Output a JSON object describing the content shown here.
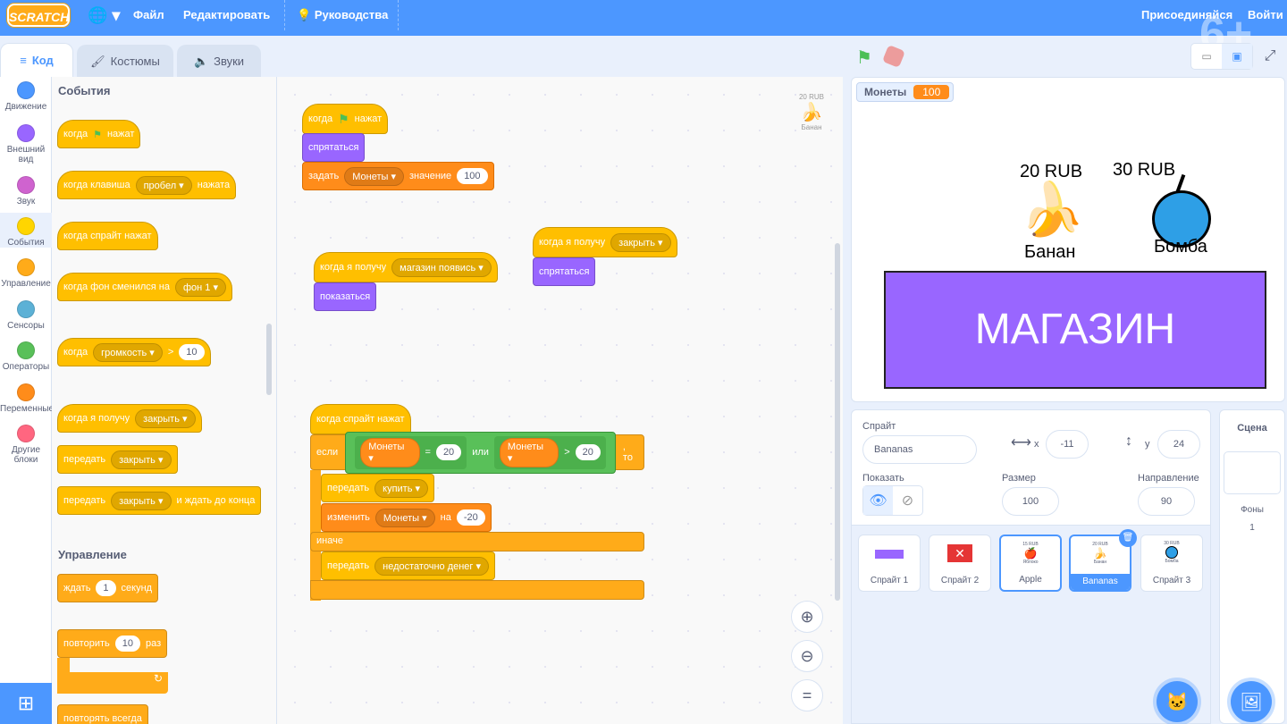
{
  "menubar": {
    "logo": "SCRATCH",
    "file": "Файл",
    "edit": "Редактировать",
    "tutorials": "Руководства",
    "join": "Присоединяйся",
    "signin": "Войти",
    "age_badge": "6+"
  },
  "tabs": {
    "code": "Код",
    "costumes": "Костюмы",
    "sounds": "Звуки"
  },
  "categories": [
    {
      "label": "Движение",
      "color": "#4c97ff"
    },
    {
      "label": "Внешний вид",
      "color": "#9966ff"
    },
    {
      "label": "Звук",
      "color": "#cf63cf"
    },
    {
      "label": "События",
      "color": "#ffd500"
    },
    {
      "label": "Управление",
      "color": "#ffab19"
    },
    {
      "label": "Сенсоры",
      "color": "#5cb1d6"
    },
    {
      "label": "Операторы",
      "color": "#59c059"
    },
    {
      "label": "Переменные",
      "color": "#ff8c1a"
    },
    {
      "label": "Другие блоки",
      "color": "#ff6680"
    }
  ],
  "palette": {
    "events_title": "События",
    "when_flag": [
      "когда",
      "нажат"
    ],
    "when_key": [
      "когда клавиша",
      "пробел",
      "нажата"
    ],
    "when_sprite_clicked": "когда спрайт нажат",
    "when_backdrop": [
      "когда фон сменился на",
      "фон 1"
    ],
    "when_loudness": [
      "когда",
      "громкость",
      ">",
      "10"
    ],
    "when_receive": [
      "когда я получу",
      "закрыть"
    ],
    "broadcast": [
      "передать",
      "закрыть"
    ],
    "broadcast_wait": [
      "передать",
      "закрыть",
      "и ждать до конца"
    ],
    "control_title": "Управление",
    "wait": [
      "ждать",
      "1",
      "секунд"
    ],
    "repeat": [
      "повторить",
      "10",
      "раз"
    ],
    "forever": "повторять всегда"
  },
  "workspace": {
    "corner_price": "20 RUB",
    "corner_name": "Банан",
    "script1": {
      "hat": [
        "когда",
        "нажат"
      ],
      "hide": "спрятаться",
      "set": [
        "задать",
        "Монеты",
        "значение",
        "100"
      ]
    },
    "script2": {
      "hat": [
        "когда я получу",
        "магазин появись"
      ],
      "show": "показаться"
    },
    "script3": {
      "hat": [
        "когда я получу",
        "закрыть"
      ],
      "hide": "спрятаться"
    },
    "script4": {
      "hat": "когда спрайт нажат",
      "if": "если",
      "var1": "Монеты",
      "eq": "=",
      "val1": "20",
      "or": "или",
      "var2": "Монеты",
      "gt": ">",
      "val2": "20",
      "then": ", то",
      "broadcast": [
        "передать",
        "купить"
      ],
      "change": [
        "изменить",
        "Монеты",
        "на",
        "-20"
      ],
      "else": "иначе",
      "broadcast2": [
        "передать",
        "недостаточно денег"
      ]
    }
  },
  "stage": {
    "var_name": "Монеты",
    "var_value": "100",
    "price1": "20 RUB",
    "name1": "Банан",
    "price2": "30 RUB",
    "name2": "Бомба",
    "shop_label": "МАГАЗИН"
  },
  "sprite_info": {
    "sprite_label": "Спрайт",
    "sprite_name": "Bananas",
    "x_label": "x",
    "x": "-11",
    "y_label": "y",
    "y": "24",
    "show_label": "Показать",
    "size_label": "Размер",
    "size": "100",
    "dir_label": "Направление",
    "dir": "90"
  },
  "sprites": [
    {
      "name": "Спрайт 1"
    },
    {
      "name": "Спрайт 2"
    },
    {
      "name": "Apple",
      "thumb_price": "15 RUB",
      "thumb_name": "Яблоко"
    },
    {
      "name": "Bananas",
      "thumb_price": "20 RUB",
      "thumb_name": "Банан"
    },
    {
      "name": "Спрайт 3",
      "thumb_price": "30 RUB",
      "thumb_name": "Бомба"
    }
  ],
  "stage_panel": {
    "title": "Сцена",
    "backdrops_label": "Фоны",
    "backdrops_count": "1"
  }
}
